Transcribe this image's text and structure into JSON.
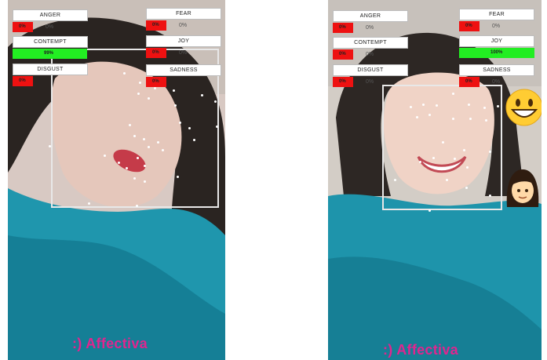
{
  "panels": [
    {
      "id": "left",
      "emotions": {
        "anger": {
          "label": "ANGER",
          "value": "0%",
          "ghost": "0%",
          "fraction": 0.27
        },
        "contempt": {
          "label": "CONTEMPT",
          "value": "99%",
          "fraction": 0.99
        },
        "disgust": {
          "label": "DISGUST",
          "value": "0%",
          "fraction": 0.27
        },
        "fear": {
          "label": "FEAR",
          "value": "0%",
          "ghost": "0%",
          "fraction": 0.27
        },
        "joy": {
          "label": "JOY",
          "value": "0%",
          "ghost": "0%",
          "fraction": 0.27
        },
        "sadness": {
          "label": "SADNESS",
          "value": "0%",
          "fraction": 0.27
        }
      },
      "logo": ":) Affectiva"
    },
    {
      "id": "right",
      "emotions": {
        "anger": {
          "label": "ANGER",
          "value": "0%",
          "ghost": "0%",
          "fraction": 0.27
        },
        "contempt": {
          "label": "CONTEMPT",
          "value": "0%",
          "ghost": "0%",
          "fraction": 0.27
        },
        "disgust": {
          "label": "DISGUST",
          "value": "0%",
          "ghost": "0%",
          "fraction": 0.27
        },
        "fear": {
          "label": "FEAR",
          "value": "0%",
          "ghost": "0%",
          "fraction": 0.27
        },
        "joy": {
          "label": "JOY",
          "value": "100%",
          "fraction": 1.0
        },
        "sadness": {
          "label": "SADNESS",
          "value": "0%",
          "ghost": "0%",
          "fraction": 0.27
        }
      },
      "emojis": [
        "grinning-face-emoji",
        "woman-emoji"
      ],
      "logo": ":) Affectiva"
    }
  ],
  "colors": {
    "bar_low": "#ee1111",
    "bar_high": "#22ee22",
    "logo": "#e0258f",
    "sweater": "#1b8fa8"
  }
}
